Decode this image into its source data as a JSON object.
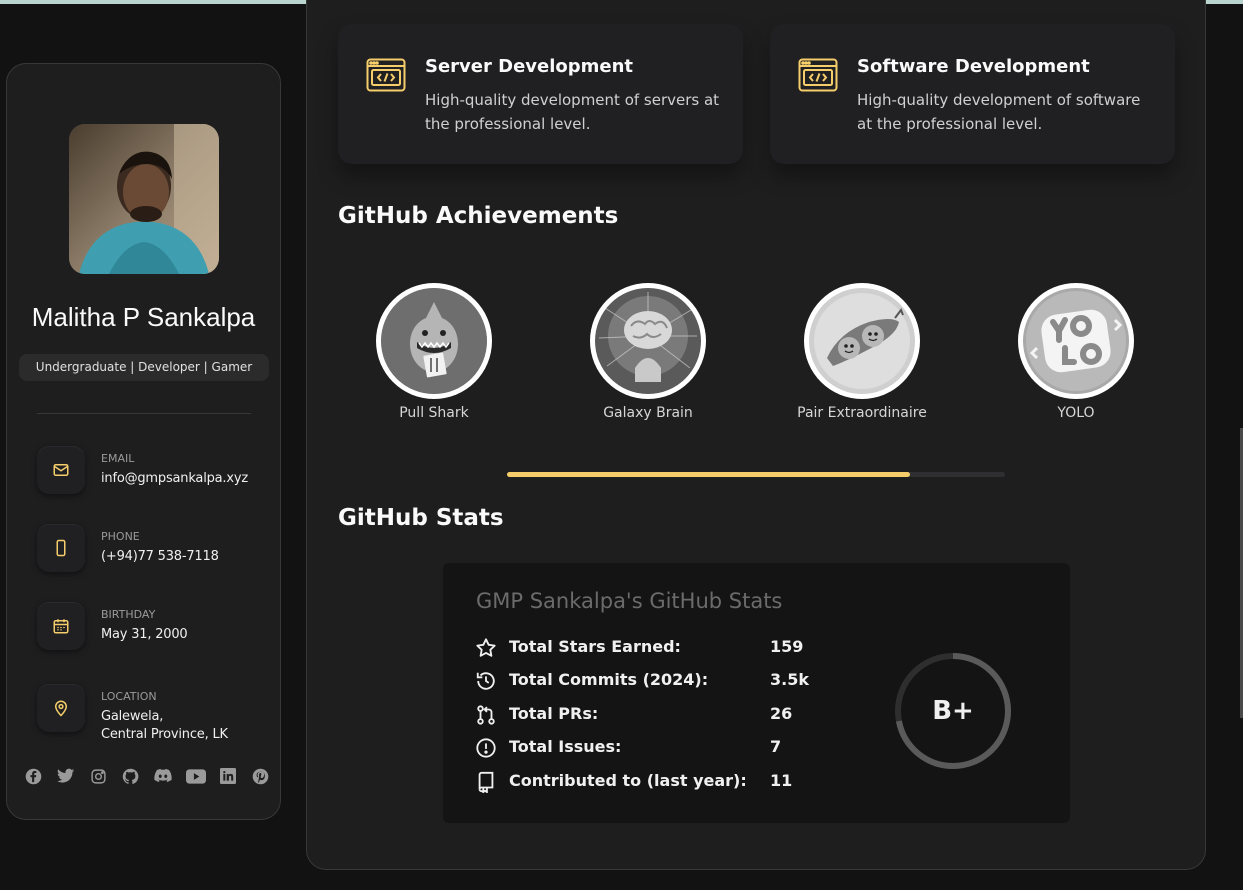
{
  "profile": {
    "name": "Malitha P Sankalpa",
    "title": "Undergraduate | Developer | Gamer"
  },
  "contacts": [
    {
      "label": "Email",
      "value": "info@gmpsankalpa.xyz",
      "icon": "mail-icon"
    },
    {
      "label": "Phone",
      "value": "(+94)77 538-7118",
      "icon": "phone-icon"
    },
    {
      "label": "Birthday",
      "value": "May 31, 2000",
      "icon": "calendar-icon"
    },
    {
      "label": "Location",
      "value_line1": "Galewela,",
      "value_line2": "Central Province, LK",
      "icon": "location-pin-icon"
    }
  ],
  "socials": [
    "facebook-icon",
    "twitter-icon",
    "instagram-icon",
    "github-icon",
    "discord-icon",
    "youtube-icon",
    "linkedin-icon",
    "pinterest-icon"
  ],
  "services": [
    {
      "title": "Server Development",
      "desc": "High-quality development of servers at the professional level.",
      "icon": "code-window-icon"
    },
    {
      "title": "Software Development",
      "desc": "High-quality development of software at the professional level.",
      "icon": "code-window-icon"
    }
  ],
  "achievements": {
    "heading": "GitHub Achievements",
    "badges": [
      {
        "label": "Pull Shark"
      },
      {
        "label": "Galaxy Brain"
      },
      {
        "label": "Pair Extraordinaire"
      },
      {
        "label": "YOLO"
      }
    ],
    "carousel_progress": 0.81
  },
  "stats": {
    "heading": "GitHub Stats",
    "card_title": "GMP Sankalpa's GitHub Stats",
    "rows": [
      {
        "label": "Total Stars Earned:",
        "value": "159",
        "icon": "star-icon"
      },
      {
        "label": "Total Commits (2024):",
        "value": "3.5k",
        "icon": "history-icon"
      },
      {
        "label": "Total PRs:",
        "value": "26",
        "icon": "pull-request-icon"
      },
      {
        "label": "Total Issues:",
        "value": "7",
        "icon": "issue-icon"
      },
      {
        "label": "Contributed to (last year):",
        "value": "11",
        "icon": "repo-icon"
      }
    ],
    "rank": "B+",
    "rank_progress": 0.72
  },
  "colors": {
    "accent": "#f5cd6a",
    "card_bg": "#1e1e1f",
    "page_bg": "#121212"
  }
}
